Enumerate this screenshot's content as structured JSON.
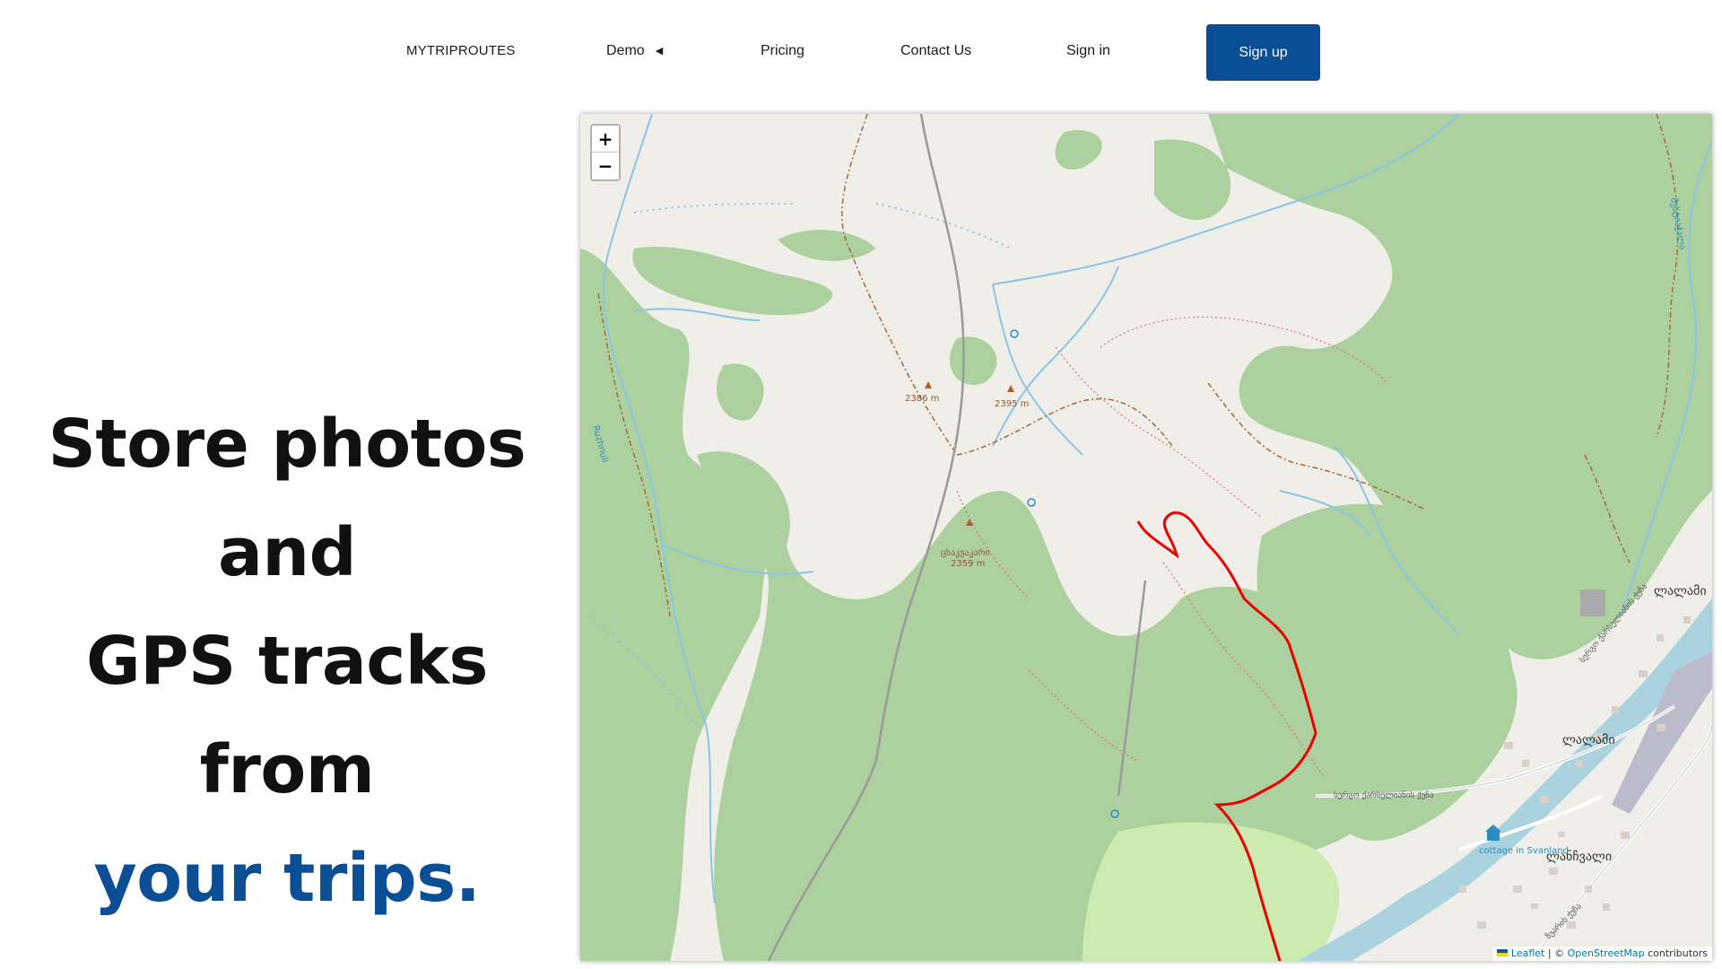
{
  "nav": {
    "brand": "MYTRIPROUTES",
    "demo": "Demo",
    "demo_caret": "◀",
    "pricing": "Pricing",
    "contact": "Contact Us",
    "signin": "Sign in",
    "signup": "Sign up"
  },
  "hero": {
    "line1": "Store photos and",
    "line2": "GPS tracks from",
    "line3": "your trips."
  },
  "map": {
    "zoom_in": "+",
    "zoom_out": "−",
    "attribution": {
      "leaflet": "Leaflet",
      "sep": " | © ",
      "osm": "OpenStreetMap",
      "suffix": " contributors"
    },
    "labels": {
      "peak1": "2386 m",
      "peak2": "2395 m",
      "peak3_name": "ცხაკვაკარი",
      "peak3_elev": "2359 m",
      "village1": "ლალამი",
      "village2": "ლალამი",
      "village3": "ლანჩვალი",
      "road1": "სერგო ქარსელიანის ქუჩა",
      "road2": "სერგო ქარსელიანის ქუჩა",
      "road3": "ზუარის ქუჩა",
      "poi_name": "cottage in Svanland",
      "river1": "Ruzhnuli",
      "river2": "მესტიაჭალა"
    },
    "colors": {
      "land": "#f0eee8",
      "forest": "#add19e",
      "track": "#ee0000",
      "water": "#aad3df",
      "stream": "#8bc4e4"
    }
  }
}
